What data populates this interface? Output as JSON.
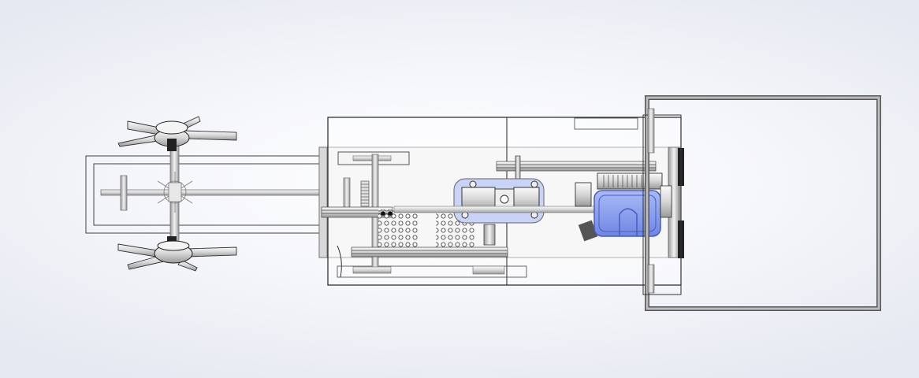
{
  "colors": {
    "background_center": "#ffffff",
    "background_edge": "#e6e9f1",
    "outline": "#2f2f2f",
    "part_fill": "#ececec",
    "shadow": "#bdbdbd",
    "engine_blue": "#8aa2f0",
    "engine_blue_dark": "#5b6fd1"
  },
  "view": {
    "type": "CAD top view of machine assembly",
    "visible_text": []
  },
  "icons": [
    "rotor-hub-icon",
    "gear-icon",
    "engine-icon",
    "pulley-icon"
  ]
}
